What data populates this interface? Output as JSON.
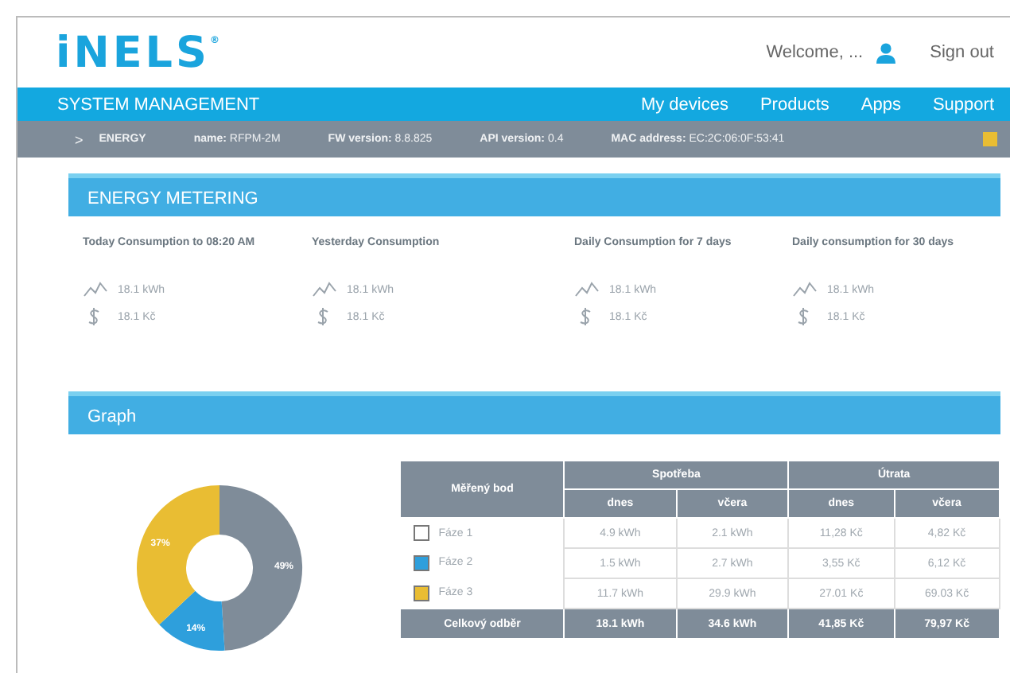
{
  "header": {
    "logo": "iNELS",
    "logo_mark": "®",
    "welcome": "Welcome, ...",
    "sign_out": "Sign out"
  },
  "nav": {
    "title": "SYSTEM MANAGEMENT",
    "links": [
      "My devices",
      "Products",
      "Apps",
      "Support"
    ]
  },
  "device_bar": {
    "arrow": ">",
    "name": "ENERGY",
    "fields": [
      {
        "label": "name:",
        "value": "RFPM-2M"
      },
      {
        "label": "FW version:",
        "value": "8.8.825"
      },
      {
        "label": "API version:",
        "value": "0.4"
      },
      {
        "label": "MAC address:",
        "value": "EC:2C:06:0F:53:41"
      }
    ]
  },
  "metering": {
    "title": "ENERGY METERING",
    "cards": [
      {
        "title": "Today Consumption to 08:20 AM",
        "energy": "18.1 kWh",
        "cost": "18.1 Kč"
      },
      {
        "title": "Yesterday Consumption",
        "energy": "18.1 kWh",
        "cost": "18.1 Kč"
      },
      {
        "title": "Daily Consumption for 7 days",
        "energy": "18.1 kWh",
        "cost": "18.1 Kč"
      },
      {
        "title": "Daily consumption for 30 days",
        "energy": "18.1 kWh",
        "cost": "18.1 Kč"
      }
    ]
  },
  "graph": {
    "title": "Graph",
    "chart_data": {
      "type": "donut",
      "values": [
        49,
        14,
        37
      ],
      "value_labels": [
        "49%",
        "14%",
        "37%"
      ]
    },
    "table": {
      "point_header": "Měřený bod",
      "groups": [
        "Spotřeba",
        "Útrata"
      ],
      "subheaders": [
        "dnes",
        "včera",
        "dnes",
        "včera"
      ],
      "rows": [
        {
          "name": "Fáze 1",
          "color": "#ffffff",
          "cells": [
            "4.9 kWh",
            "2.1 kWh",
            "11,28 Kč",
            "4,82 Kč"
          ]
        },
        {
          "name": "Fáze 2",
          "color": "#2e9fdc",
          "cells": [
            "1.5 kWh",
            "2.7 kWh",
            "3,55 Kč",
            "6,12 Kč"
          ]
        },
        {
          "name": "Fáze 3",
          "color": "#e9bd33",
          "cells": [
            "11.7 kWh",
            "29.9 kWh",
            "27.01 Kč",
            "69.03 Kč"
          ]
        }
      ],
      "total": {
        "label": "Celkový odběr",
        "cells": [
          "18.1 kWh",
          "34.6 kWh",
          "41,85 Kč",
          "79,97 Kč"
        ]
      }
    }
  }
}
